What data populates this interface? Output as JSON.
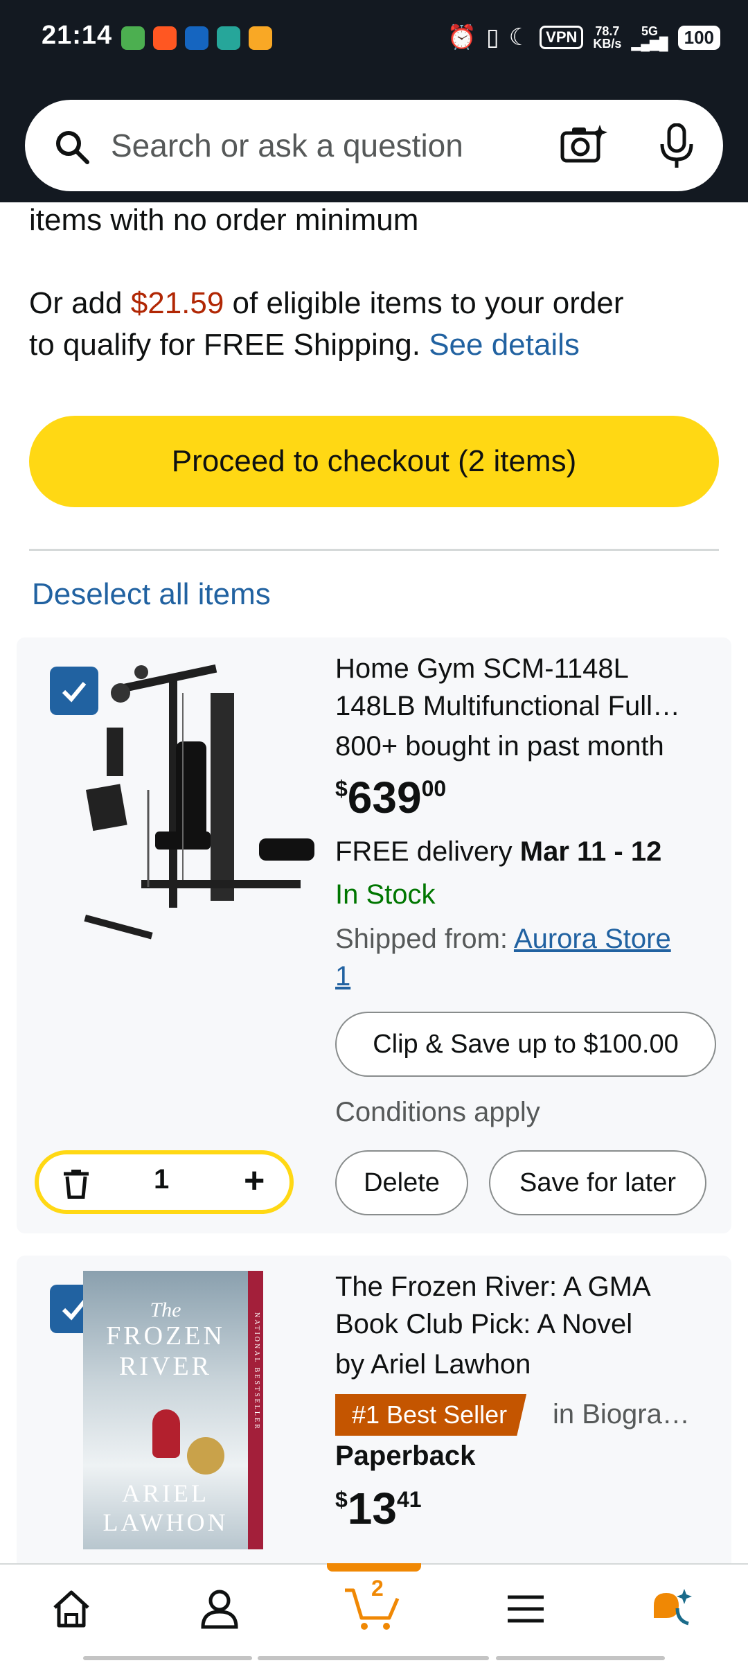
{
  "status_bar": {
    "time": "21:14",
    "vpn": "VPN",
    "speed_value": "78.7",
    "speed_unit": "KB/s",
    "network": "5G",
    "battery": "100"
  },
  "search": {
    "placeholder": "Search or ask a question"
  },
  "free_shipping": {
    "line_cut": "items with no order minimum",
    "prefix": "Or add ",
    "amount": "$21.59",
    "middle": " of eligible items to your order",
    "line2": "to qualify for FREE Shipping. ",
    "see_details": "See details"
  },
  "checkout": {
    "label": "Proceed to checkout (2 items)"
  },
  "deselect": {
    "label": "Deselect all items"
  },
  "items": [
    {
      "title_line1": "Home Gym SCM-1148L",
      "title_line2": "148LB Multifunctional Full…",
      "bought": "800+ bought in past month",
      "price_currency": "$",
      "price_whole": "639",
      "price_cents": "00",
      "delivery_prefix": "FREE delivery ",
      "delivery_date": "Mar 11 - 12",
      "stock": "In Stock",
      "shipped_label": "Shipped from: ",
      "shipped_store_line1": "Aurora Store",
      "shipped_store_line2": "1",
      "coupon": "Clip & Save up to $100.00",
      "conditions": "Conditions apply",
      "quantity": "1",
      "delete": "Delete",
      "save_for_later": "Save for later"
    },
    {
      "title_line1": "The Frozen River: A GMA",
      "title_line2": "Book Club Pick: A Novel",
      "author": "by Ariel Lawhon",
      "badge": "#1 Best Seller",
      "badge_category": "in Biogra…",
      "format": "Paperback",
      "price_currency": "$",
      "price_whole": "13",
      "price_cents": "41",
      "cover_title_1": "The",
      "cover_title_2": "FROZEN",
      "cover_title_3": "RIVER",
      "cover_author_1": "ARIEL",
      "cover_author_2": "LAWHON",
      "cover_side": "NATIONAL BESTSELLER"
    }
  ],
  "bottom_nav": {
    "cart_count": "2"
  },
  "colors": {
    "header_bg": "#131921",
    "checkout_yellow": "#ffd814",
    "link_blue": "#2162a1",
    "price_red": "#b12704",
    "stock_green": "#007600",
    "badge_orange": "#c45500",
    "cart_orange": "#f08804"
  }
}
